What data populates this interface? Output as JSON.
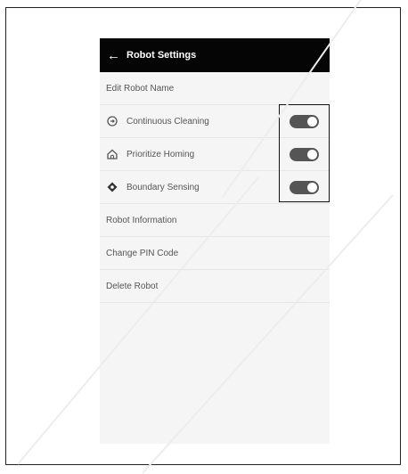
{
  "header": {
    "back_icon": "arrow-left-icon",
    "title": "Robot Settings"
  },
  "menu": {
    "edit_name": "Edit Robot Name",
    "toggles": [
      {
        "label": "Continuous Cleaning",
        "icon": "continuous-cleaning-icon",
        "on": true
      },
      {
        "label": "Prioritize Homing",
        "icon": "home-icon",
        "on": true
      },
      {
        "label": "Boundary Sensing",
        "icon": "boundary-sensing-icon",
        "on": true
      }
    ],
    "robot_information": "Robot Information",
    "change_pin": "Change PIN Code",
    "delete_robot": "Delete Robot"
  },
  "colors": {
    "header_bg": "#050505",
    "toggle_on": "#555555",
    "screen_bg": "#f5f5f5"
  }
}
